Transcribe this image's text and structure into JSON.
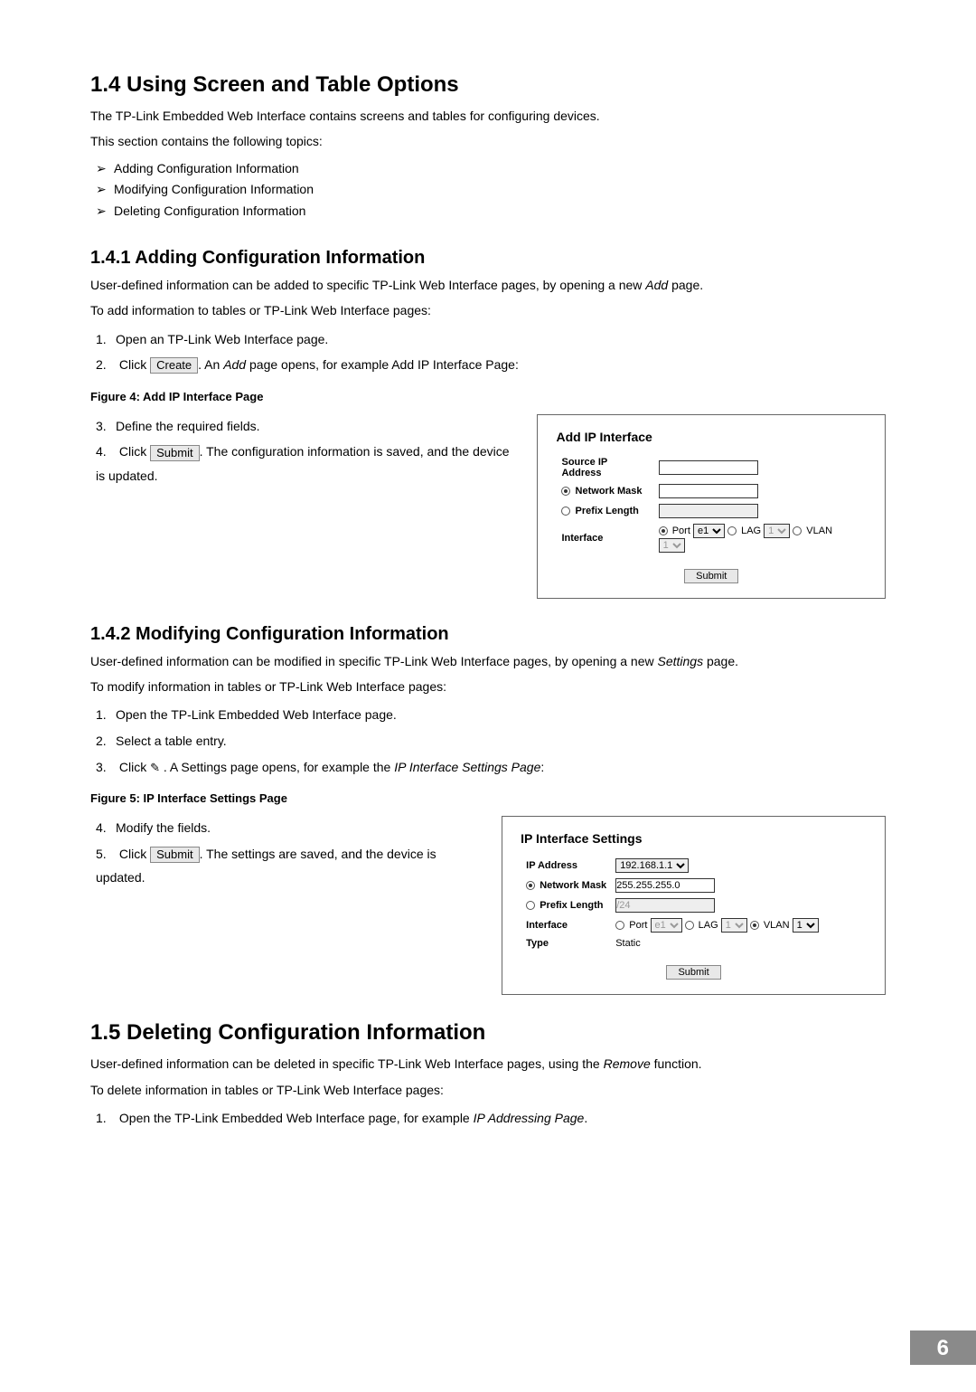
{
  "s14": {
    "heading": "1.4  Using Screen and Table Options",
    "intro": "The TP-Link Embedded Web Interface contains screens and tables for configuring devices.",
    "topics_lead": "This section contains the following topics:",
    "topics": [
      "Adding Configuration Information",
      "Modifying Configuration Information",
      "Deleting Configuration Information"
    ]
  },
  "s141": {
    "heading": "1.4.1  Adding Configuration Information",
    "intro": "User-defined information can be added to specific TP-Link Web Interface pages, by opening a new",
    "intro_italic": "Add",
    "intro_tail": "page.",
    "lead": "To add information to tables or TP-Link Web Interface pages:",
    "step1": "Open an TP-Link Web Interface page.",
    "step2a": "Click",
    "step2btn": "Create",
    "step2b": ". An",
    "step2italic": "Add",
    "step2c": "page opens, for example Add IP Interface Page:",
    "fig": "Figure 4: Add IP Interface Page",
    "step3": "Define the required fields.",
    "step4a": "Click",
    "step4btn": "Submit",
    "step4b": ". The configuration information is saved, and the device is updated."
  },
  "panel1": {
    "title": "Add IP Interface",
    "source": "Source IP Address",
    "netmask": "Network Mask",
    "prefix": "Prefix Length",
    "iface": "Interface",
    "port": "Port",
    "port_val": "e1",
    "lag": "LAG",
    "lag_val": "1",
    "vlan": "VLAN",
    "vlan_val": "1",
    "submit": "Submit"
  },
  "s142": {
    "heading": "1.4.2  Modifying Configuration Information",
    "intro_a": "User-defined information can be modified in specific TP-Link Web Interface pages, by opening a new",
    "intro_italic": "Settings",
    "intro_b": "page.",
    "lead": "To modify information in tables or TP-Link Web Interface pages:",
    "step1": "Open the TP-Link Embedded Web Interface page.",
    "step2": "Select a table entry.",
    "step3a": "Click",
    "step3b": ". A Settings page opens, for example the",
    "step3italic": "IP Interface Settings Page",
    "step3c": ":",
    "fig": "Figure 5: IP Interface Settings Page",
    "step4": "Modify the fields.",
    "step5a": "Click",
    "step5btn": "Submit",
    "step5b": ". The settings are saved, and the device is updated."
  },
  "panel2": {
    "title": "IP Interface Settings",
    "ip": "IP Address",
    "ip_val": "192.168.1.1",
    "netmask": "Network Mask",
    "netmask_val": "255.255.255.0",
    "prefix": "Prefix Length",
    "prefix_val": "/24",
    "iface": "Interface",
    "port": "Port",
    "port_val": "e1",
    "lag": "LAG",
    "lag_val": "1",
    "vlan": "VLAN",
    "vlan_val": "1",
    "type": "Type",
    "type_val": "Static",
    "submit": "Submit"
  },
  "s15": {
    "heading": "1.5  Deleting Configuration Information",
    "intro_a": "User-defined information can be deleted in specific TP-Link Web Interface pages, using the",
    "intro_italic": "Remove",
    "intro_b": "function.",
    "lead": "To delete information in tables or TP-Link Web Interface pages:",
    "step1a": "Open the TP-Link Embedded Web Interface page, for example",
    "step1italic": "IP Addressing Page",
    "step1b": "."
  },
  "page_number": "6"
}
